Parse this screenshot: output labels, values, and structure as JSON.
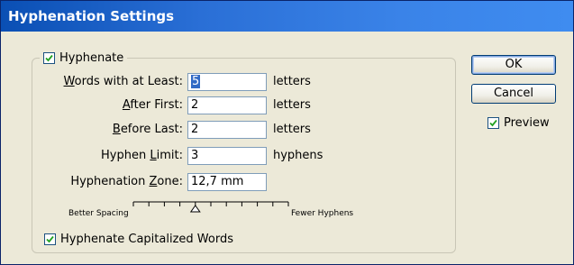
{
  "window": {
    "title": "Hyphenation Settings"
  },
  "hyphenate_group": {
    "label": "Hyphenate",
    "checked": true,
    "fields": [
      {
        "label_pre": "",
        "label_ul": "W",
        "label_post": "ords with at Least:",
        "value": "5",
        "unit": "letters"
      },
      {
        "label_pre": "",
        "label_ul": "A",
        "label_post": "fter First:",
        "value": "2",
        "unit": "letters"
      },
      {
        "label_pre": "",
        "label_ul": "B",
        "label_post": "efore Last:",
        "value": "2",
        "unit": "letters"
      },
      {
        "label_pre": "Hyphen ",
        "label_ul": "L",
        "label_post": "imit:",
        "value": "3",
        "unit": "hyphens"
      },
      {
        "label_pre": "Hyphenation ",
        "label_ul": "Z",
        "label_post": "one:",
        "value": "12,7 mm",
        "unit": ""
      }
    ],
    "slider": {
      "left_label": "Better Spacing",
      "right_label": "Fewer Hyphens",
      "ticks": 11,
      "position": 0.4
    },
    "capitalized": {
      "label": "Hyphenate Capitalized Words",
      "checked": true
    }
  },
  "buttons": {
    "ok": "OK",
    "cancel": "Cancel"
  },
  "preview": {
    "label": "Preview",
    "checked": true
  },
  "colors": {
    "title_bar": "#2a6fd6",
    "dialog_bg": "#ece9d8",
    "selection": "#316ac5"
  }
}
